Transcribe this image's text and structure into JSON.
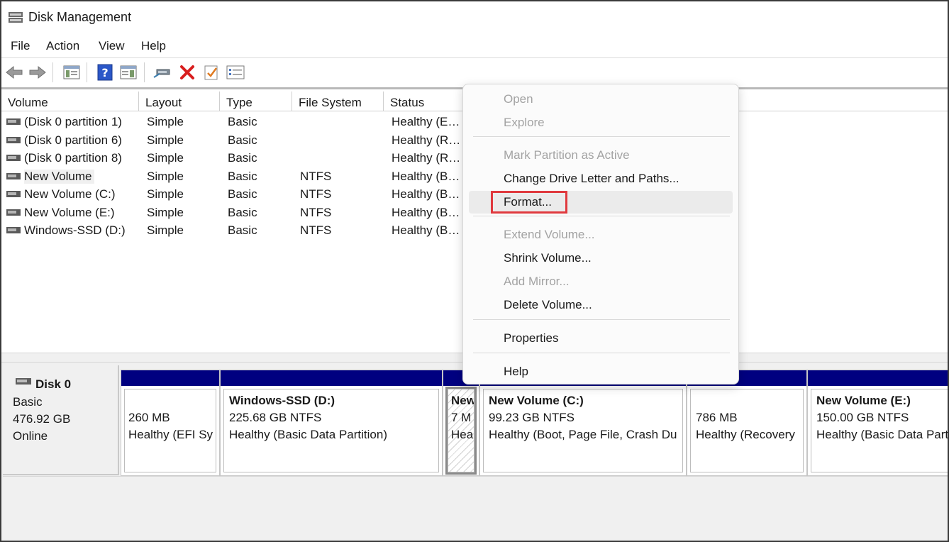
{
  "window": {
    "title": "Disk Management"
  },
  "menu": [
    "File",
    "Action",
    "View",
    "Help"
  ],
  "toolbar": {
    "icons": [
      "back-arrow-icon",
      "forward-arrow-icon",
      "console-tree-icon",
      "help-icon",
      "show-hide-icon",
      "connect-icon",
      "delete-icon",
      "checklist-icon",
      "properties-icon"
    ],
    "colors": {
      "delete": "#d81e1e",
      "help": "#2b57c8"
    }
  },
  "volume_list": {
    "columns": [
      "Volume",
      "Layout",
      "Type",
      "File System",
      "Status"
    ],
    "rows": [
      {
        "volume": "(Disk 0 partition 1)",
        "layout": "Simple",
        "type": "Basic",
        "fs": "",
        "status": "Healthy (E…"
      },
      {
        "volume": "(Disk 0 partition 6)",
        "layout": "Simple",
        "type": "Basic",
        "fs": "",
        "status": "Healthy (R…"
      },
      {
        "volume": "(Disk 0 partition 8)",
        "layout": "Simple",
        "type": "Basic",
        "fs": "",
        "status": "Healthy (R…"
      },
      {
        "volume": "New Volume",
        "layout": "Simple",
        "type": "Basic",
        "fs": "NTFS",
        "status": "Healthy (B…"
      },
      {
        "volume": "New Volume (C:)",
        "layout": "Simple",
        "type": "Basic",
        "fs": "NTFS",
        "status": "Healthy (B…"
      },
      {
        "volume": "New Volume (E:)",
        "layout": "Simple",
        "type": "Basic",
        "fs": "NTFS",
        "status": "Healthy (B…"
      },
      {
        "volume": "Windows-SSD (D:)",
        "layout": "Simple",
        "type": "Basic",
        "fs": "NTFS",
        "status": "Healthy (B…"
      }
    ]
  },
  "disk": {
    "name": "Disk 0",
    "type": "Basic",
    "size": "476.92 GB",
    "state": "Online",
    "partitions": [
      {
        "title": "",
        "size": "260 MB",
        "status": "Healthy (EFI Sy"
      },
      {
        "title": "Windows-SSD  (D:)",
        "size": "225.68 GB NTFS",
        "status": "Healthy (Basic Data Partition)"
      },
      {
        "title": "New",
        "size": "7 M",
        "status": "Hea"
      },
      {
        "title": "New Volume  (C:)",
        "size": "99.23 GB NTFS",
        "status": "Healthy (Boot, Page File, Crash Du"
      },
      {
        "title": "",
        "size": "786 MB",
        "status": "Healthy (Recovery"
      },
      {
        "title": "New Volume  (E:)",
        "size": "150.00 GB NTFS",
        "status": "Healthy (Basic Data Part"
      }
    ],
    "bar_color": "#000080"
  },
  "context_menu": {
    "items": [
      {
        "label": "Open",
        "enabled": false
      },
      {
        "label": "Explore",
        "enabled": false
      },
      {
        "label": "Mark Partition as Active",
        "enabled": false
      },
      {
        "label": "Change Drive Letter and Paths...",
        "enabled": true
      },
      {
        "label": "Format...",
        "enabled": true
      },
      {
        "label": "Extend Volume...",
        "enabled": false
      },
      {
        "label": "Shrink Volume...",
        "enabled": true
      },
      {
        "label": "Add Mirror...",
        "enabled": false
      },
      {
        "label": "Delete Volume...",
        "enabled": true
      },
      {
        "label": "Properties",
        "enabled": true
      },
      {
        "label": "Help",
        "enabled": true
      }
    ],
    "highlight_color": "#e0393e"
  }
}
